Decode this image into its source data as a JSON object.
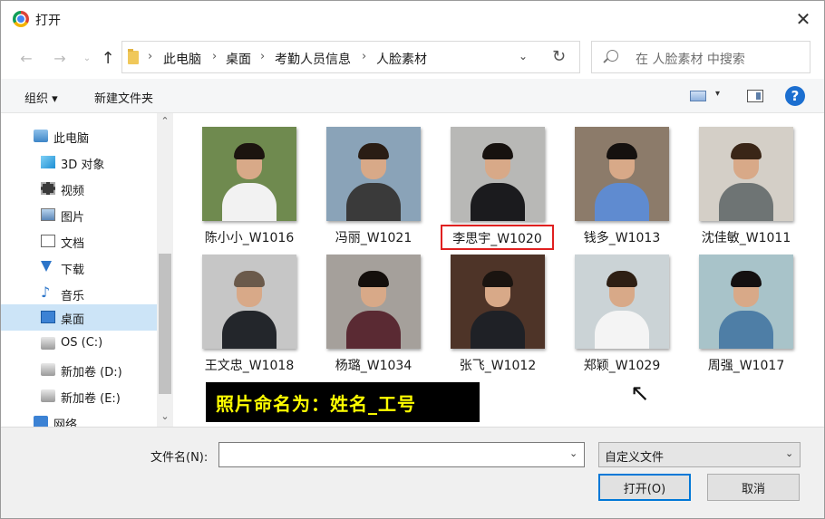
{
  "title": "打开",
  "close_symbol": "✕",
  "nav": {
    "back": "←",
    "forward": "→",
    "recent": "⌄",
    "up": "↑"
  },
  "breadcrumbs": [
    "此电脑",
    "桌面",
    "考勤人员信息",
    "人脸素材"
  ],
  "breadcrumb_sep": "›",
  "address_dropdown": "⌄",
  "refresh_symbol": "↻",
  "search": {
    "placeholder": "在 人脸素材 中搜索"
  },
  "toolbar": {
    "organize": "组织 ▾",
    "new_folder": "新建文件夹",
    "view_drop": "▾",
    "help": "?"
  },
  "sidebar": {
    "scroll_up": "⌃",
    "scroll_down": "⌄",
    "items": [
      {
        "label": "此电脑",
        "icon": "computer-icon",
        "selected": false
      },
      {
        "label": "3D 对象",
        "icon": "3d-objects-icon",
        "selected": false
      },
      {
        "label": "视频",
        "icon": "video-icon",
        "selected": false
      },
      {
        "label": "图片",
        "icon": "picture-icon",
        "selected": false
      },
      {
        "label": "文档",
        "icon": "document-icon",
        "selected": false
      },
      {
        "label": "下载",
        "icon": "download-icon",
        "selected": false
      },
      {
        "label": "音乐",
        "icon": "music-icon",
        "selected": false
      },
      {
        "label": "桌面",
        "icon": "desktop-icon",
        "selected": true
      },
      {
        "label": "OS (C:)",
        "icon": "drive-c-icon",
        "selected": false
      },
      {
        "label": "新加卷 (D:)",
        "icon": "drive-d-icon",
        "selected": false
      },
      {
        "label": "新加卷 (E:)",
        "icon": "drive-e-icon",
        "selected": false
      },
      {
        "label": "网络",
        "icon": "network-icon",
        "selected": false
      }
    ]
  },
  "files": [
    {
      "name": "陈小小_W1016",
      "bg": "#6f8a4f",
      "outfit": "#f2f2f2",
      "hair": "#1c140f",
      "highlight": false
    },
    {
      "name": "冯丽_W1021",
      "bg": "#8aa3b8",
      "outfit": "#3a3a3a",
      "hair": "#2a1d14",
      "highlight": false
    },
    {
      "name": "李思宇_W1020",
      "bg": "#b8b8b6",
      "outfit": "#1b1b1e",
      "hair": "#17120f",
      "highlight": true
    },
    {
      "name": "钱多_W1013",
      "bg": "#8c7b6a",
      "outfit": "#5f8bd0",
      "hair": "#15110f",
      "highlight": false
    },
    {
      "name": "沈佳敏_W1011",
      "bg": "#d4cfc7",
      "outfit": "#6e7474",
      "hair": "#3a2617",
      "highlight": false
    },
    {
      "name": "王文忠_W1018",
      "bg": "#c6c6c6",
      "outfit": "#23262b",
      "hair": "#6b5a4b",
      "highlight": false
    },
    {
      "name": "杨璐_W1034",
      "bg": "#a5a09b",
      "outfit": "#5a2a33",
      "hair": "#140f0c",
      "highlight": false
    },
    {
      "name": "张飞_W1012",
      "bg": "#4e3428",
      "outfit": "#1f2126",
      "hair": "#1a1410",
      "highlight": false
    },
    {
      "name": "郑颖_W1029",
      "bg": "#cbd3d6",
      "outfit": "#f4f4f4",
      "hair": "#2e1f14",
      "highlight": false
    },
    {
      "name": "周强_W1017",
      "bg": "#a8c3c9",
      "outfit": "#4e7ea6",
      "hair": "#141010",
      "highlight": false
    }
  ],
  "overlay_note": "照片命名为：姓名_工号",
  "bottom": {
    "filename_label": "文件名(N):",
    "filename_value": "",
    "filename_drop": "⌄",
    "filter_value": "自定义文件",
    "filter_drop": "⌄",
    "open_button": "打开(O)",
    "cancel_button": "取消"
  }
}
